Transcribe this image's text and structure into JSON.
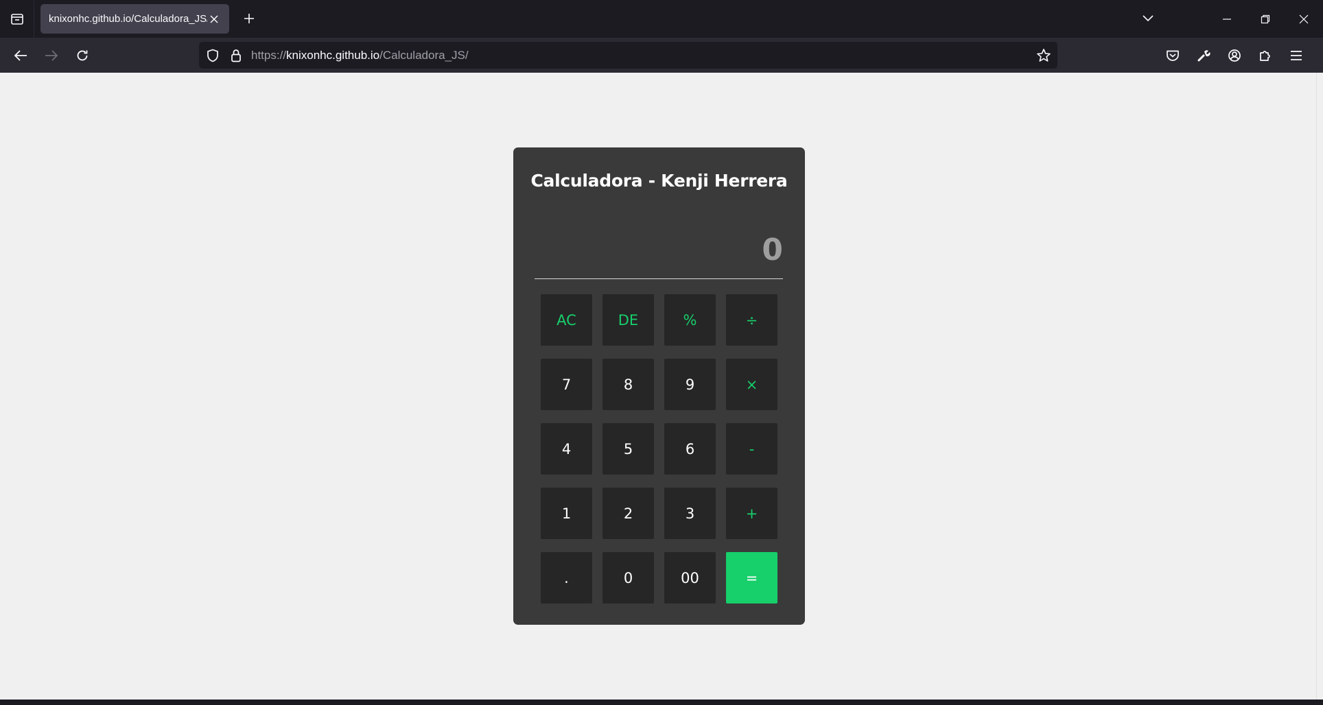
{
  "browser": {
    "tab_title": "knixonhc.github.io/Calculadora_JS/",
    "url_scheme": "https://",
    "url_host": "knixonhc.github.io",
    "url_path": "/Calculadora_JS/"
  },
  "calculator": {
    "title": "Calculadora - Kenji Herrera",
    "display_value": "0",
    "keys": [
      {
        "label": "AC",
        "name": "ac-button",
        "kind": "op"
      },
      {
        "label": "DE",
        "name": "delete-button",
        "kind": "op"
      },
      {
        "label": "%",
        "name": "percent-button",
        "kind": "op"
      },
      {
        "label": "÷",
        "name": "divide-button",
        "kind": "op"
      },
      {
        "label": "7",
        "name": "digit-7-button",
        "kind": "num"
      },
      {
        "label": "8",
        "name": "digit-8-button",
        "kind": "num"
      },
      {
        "label": "9",
        "name": "digit-9-button",
        "kind": "num"
      },
      {
        "label": "×",
        "name": "multiply-button",
        "kind": "op"
      },
      {
        "label": "4",
        "name": "digit-4-button",
        "kind": "num"
      },
      {
        "label": "5",
        "name": "digit-5-button",
        "kind": "num"
      },
      {
        "label": "6",
        "name": "digit-6-button",
        "kind": "num"
      },
      {
        "label": "-",
        "name": "subtract-button",
        "kind": "op"
      },
      {
        "label": "1",
        "name": "digit-1-button",
        "kind": "num"
      },
      {
        "label": "2",
        "name": "digit-2-button",
        "kind": "num"
      },
      {
        "label": "3",
        "name": "digit-3-button",
        "kind": "num"
      },
      {
        "label": "+",
        "name": "add-button",
        "kind": "op"
      },
      {
        "label": ".",
        "name": "decimal-button",
        "kind": "num"
      },
      {
        "label": "0",
        "name": "digit-0-button",
        "kind": "num"
      },
      {
        "label": "00",
        "name": "double-zero-button",
        "kind": "num"
      },
      {
        "label": "=",
        "name": "equals-button",
        "kind": "eq"
      }
    ]
  },
  "colors": {
    "accent_green": "#17cf6b",
    "calculator_body": "#3a3a3a",
    "key_background": "#262626",
    "page_background": "#f0f0f0"
  }
}
